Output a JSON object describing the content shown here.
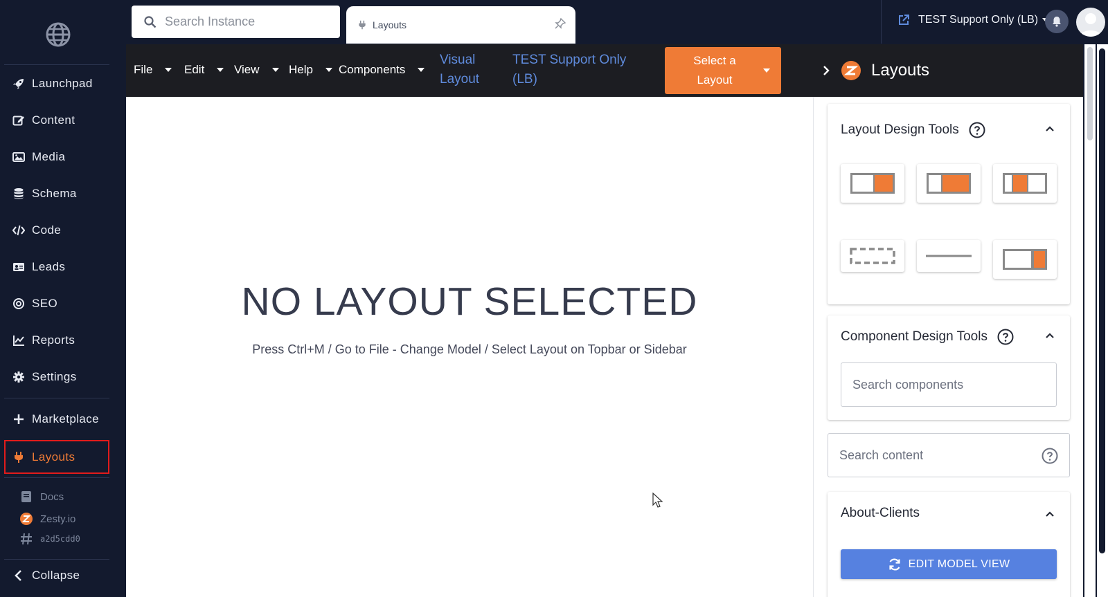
{
  "sidebar": {
    "items": [
      {
        "label": "Launchpad",
        "icon": "rocket-icon"
      },
      {
        "label": "Content",
        "icon": "edit-icon"
      },
      {
        "label": "Media",
        "icon": "image-icon"
      },
      {
        "label": "Schema",
        "icon": "database-icon"
      },
      {
        "label": "Code",
        "icon": "code-icon"
      },
      {
        "label": "Leads",
        "icon": "id-card-icon"
      },
      {
        "label": "SEO",
        "icon": "target-icon"
      },
      {
        "label": "Reports",
        "icon": "chart-line-icon"
      },
      {
        "label": "Settings",
        "icon": "gear-icon"
      }
    ],
    "marketplace": "Marketplace",
    "layouts": "Layouts",
    "docs": "Docs",
    "zesty": "Zesty.io",
    "hash": "a2d5cdd0",
    "collapse": "Collapse"
  },
  "topbar": {
    "search_placeholder": "Search Instance",
    "tab_label": "Layouts",
    "instance_name": "TEST Support Only (LB)"
  },
  "menubar": {
    "file": "File",
    "edit": "Edit",
    "view": "View",
    "help": "Help",
    "components": "Components",
    "visual_layout_1": "Visual",
    "visual_layout_2": "Layout",
    "instance_1": "TEST Support Only",
    "instance_2": "(LB)",
    "select_1": "Select a",
    "select_2": "Layout"
  },
  "canvas": {
    "title": "NO LAYOUT SELECTED",
    "subtitle": "Press Ctrl+M / Go to File - Change Model / Select Layout on Topbar or Sidebar"
  },
  "right_panel": {
    "title": "Layouts",
    "layout_tools_title": "Layout Design Tools",
    "component_tools_title": "Component Design Tools",
    "search_components_placeholder": "Search components",
    "search_content_placeholder": "Search content",
    "about_clients_title": "About-Clients",
    "edit_model_view": "EDIT MODEL VIEW"
  },
  "colors": {
    "sidebar_bg": "#131a2e",
    "accent_orange": "#ef7b36",
    "link_blue": "#5f8bdc",
    "button_blue": "#5681e0",
    "menubar_bg": "#1c1d22"
  }
}
